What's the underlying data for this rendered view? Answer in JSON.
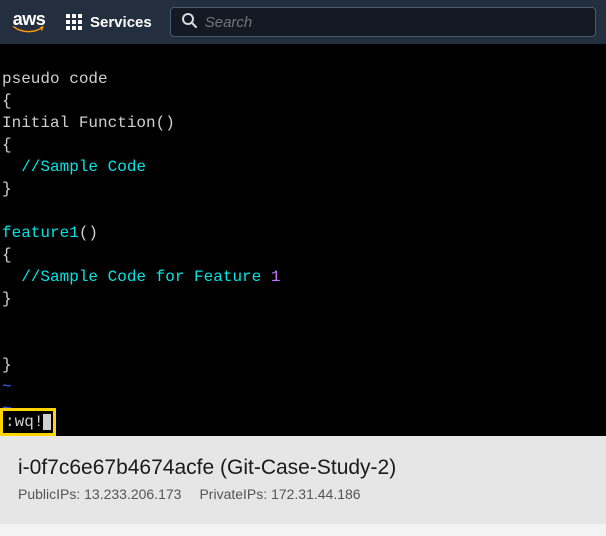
{
  "nav": {
    "logo_text": "aws",
    "services_label": "Services",
    "search_placeholder": "Search"
  },
  "terminal": {
    "l1": "pseudo code",
    "l2": "{",
    "l3": "Initial Function()",
    "l4": "{",
    "l5_indent": "  ",
    "l5_comment_slashes": "//",
    "l5_comment_text": "Sample Code",
    "l6": "}",
    "blank": "",
    "l8_fn": "feature1",
    "l8_paren": "()",
    "l9": "{",
    "l10_indent": "  ",
    "l10_comment_slashes": "//",
    "l10_part1": "Sample Code for Feature ",
    "l10_part2": "1",
    "l11": "}",
    "l_brace_close": "}",
    "tilde": "~",
    "wq_colon": ":",
    "wq_cmd": "wq!"
  },
  "footer": {
    "instance_id": "i-0f7c6e67b4674acfe",
    "instance_name": "(Git-Case-Study-2)",
    "public_label": "PublicIPs:",
    "public_ip": "13.233.206.173",
    "private_label": "PrivateIPs:",
    "private_ip": "172.31.44.186"
  }
}
